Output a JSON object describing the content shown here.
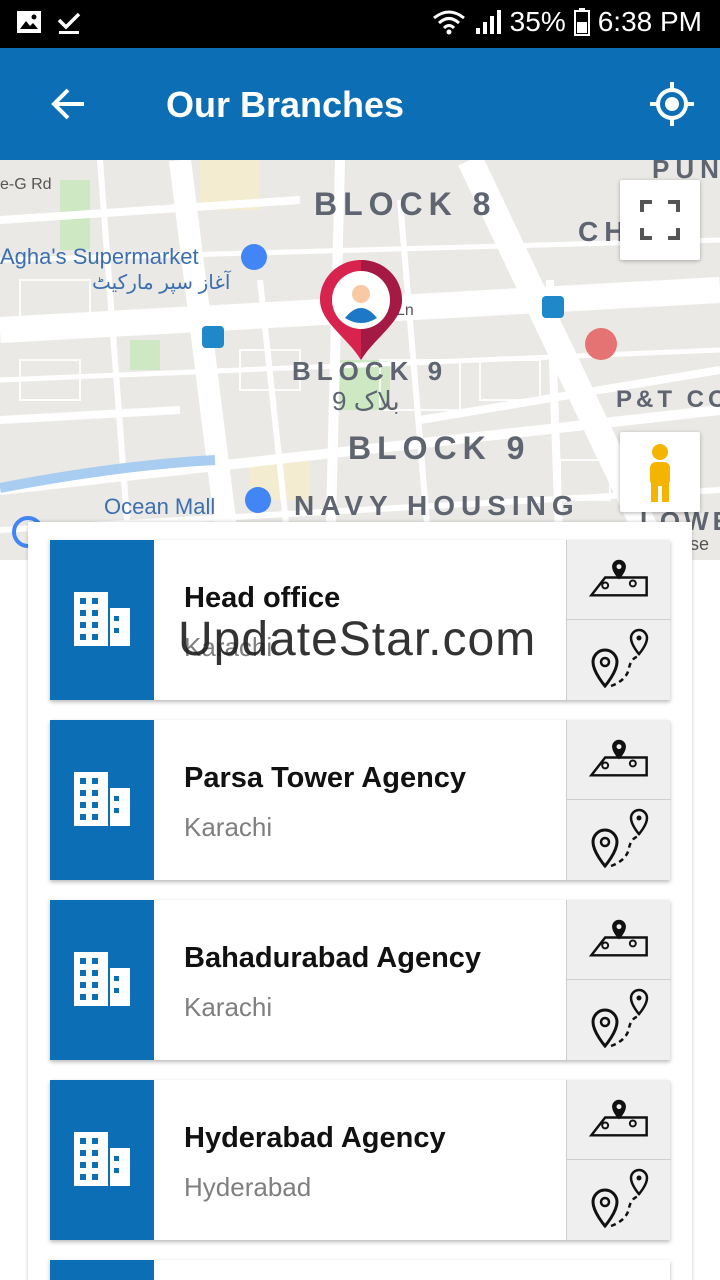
{
  "status_bar": {
    "battery": "35%",
    "time": "6:38 PM"
  },
  "app_bar": {
    "title": "Our Branches"
  },
  "map": {
    "labels": {
      "block8": "BLOCK 8",
      "block9_a": "BLOCK 9",
      "block9_b": "BLOCK 9",
      "block9_urdu": "9 بلاک",
      "navy": "NAVY HOUSING",
      "chon": "CH",
      "pt": "P&T CO",
      "lowe": "LOWE",
      "pun": "PUN",
      "road": "e-G Rd",
      "ln": "Ln",
      "se": "se"
    },
    "pois": {
      "supermarket": "Agha's Supermarket",
      "supermarket_urdu": "آغاز سپر مارکیٹ",
      "mall": "Ocean Mall"
    }
  },
  "branches": [
    {
      "name": "Head office",
      "city": "Karachi"
    },
    {
      "name": "Parsa Tower Agency",
      "city": "Karachi"
    },
    {
      "name": "Bahadurabad Agency",
      "city": "Karachi"
    },
    {
      "name": "Hyderabad Agency",
      "city": "Hyderabad"
    }
  ],
  "watermark": "UpdateStar.com",
  "colors": {
    "primary": "#0c6fb6",
    "marker": "#d8234f"
  },
  "icons": {
    "back": "arrow-left-icon",
    "locate": "gps-icon",
    "building": "building-icon",
    "map_pin": "map-pin-icon",
    "route": "route-icon"
  }
}
